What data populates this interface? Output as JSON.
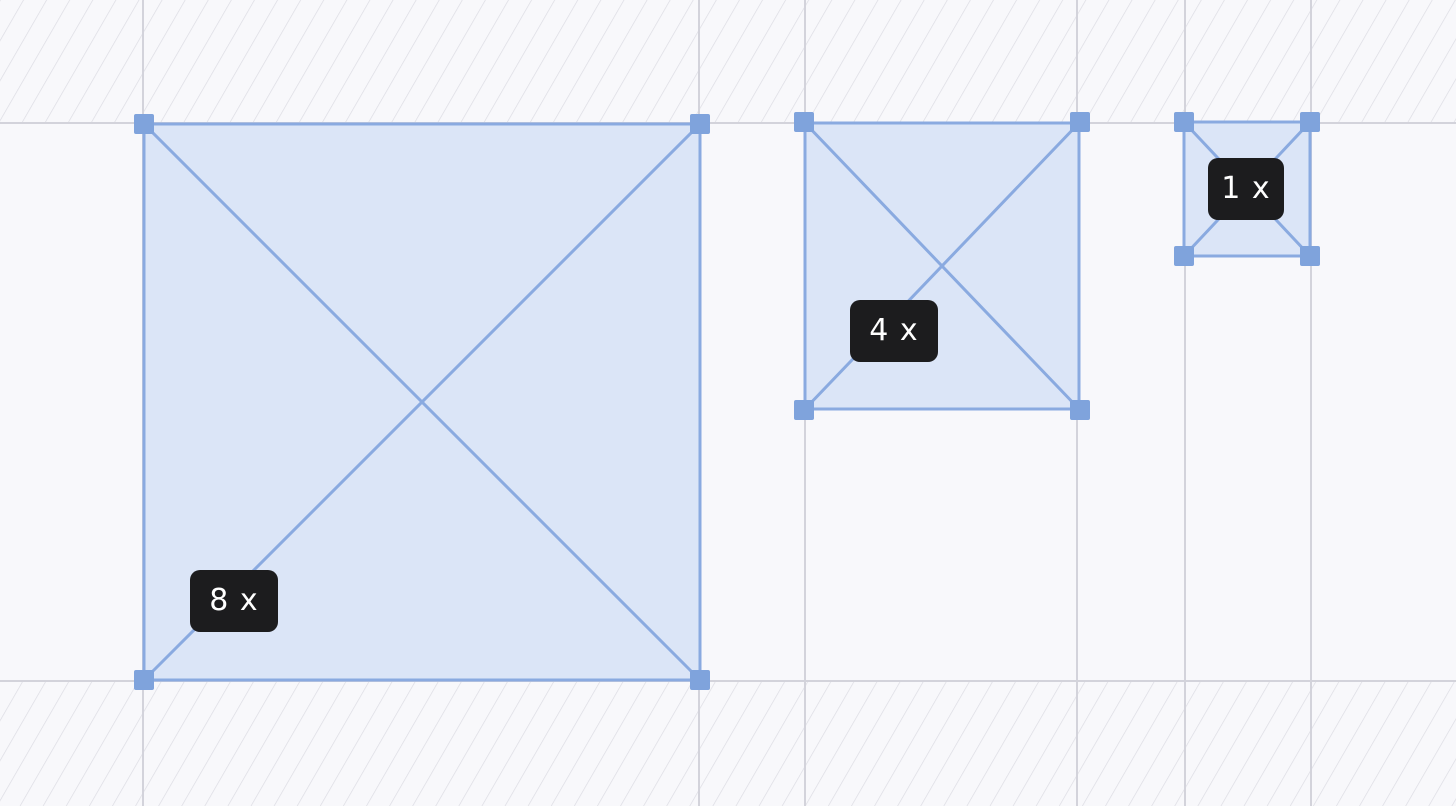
{
  "colors": {
    "background": "#f8f8fb",
    "gridline": "#d3d3db",
    "hatch": "#dcdce3",
    "frame_fill": "#dbe5f7",
    "frame_stroke": "#8aaae0",
    "handle": "#7fa3dc",
    "badge_bg": "#1c1c1e",
    "badge_text": "#ffffff"
  },
  "frames": [
    {
      "id": "frame-8x",
      "label": "8 x",
      "scale": 8
    },
    {
      "id": "frame-4x",
      "label": "4 x",
      "scale": 4
    },
    {
      "id": "frame-1x",
      "label": "1 x",
      "scale": 1
    }
  ]
}
